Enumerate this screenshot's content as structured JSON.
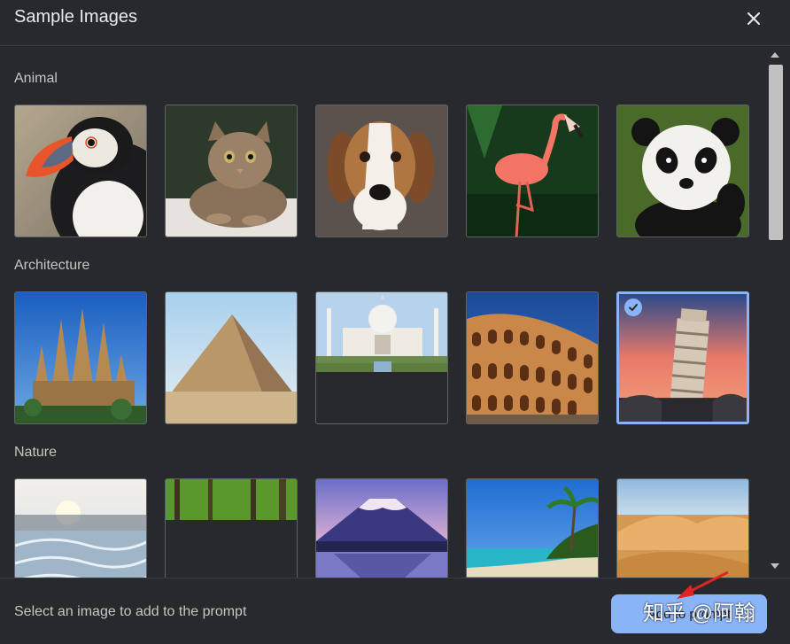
{
  "dialog": {
    "title": "Sample Images",
    "close_icon": "close-icon"
  },
  "sections": [
    {
      "label": "Animal",
      "images": [
        "puffin",
        "tabby-cat",
        "beagle",
        "flamingo",
        "panda"
      ]
    },
    {
      "label": "Architecture",
      "images": [
        "sagrada-familia",
        "pyramid",
        "taj-mahal",
        "colosseum",
        "leaning-tower-pisa"
      ]
    },
    {
      "label": "Nature",
      "images": [
        "frozen-waves",
        "forest",
        "mount-fuji",
        "tropical-beach",
        "desert-dunes"
      ]
    }
  ],
  "selected": "leaning-tower-pisa",
  "footer": {
    "hint": "Select an image to add to the prompt",
    "add_button": "Add to prompt"
  },
  "watermark": "知乎 @阿翰",
  "colors": {
    "accent": "#8ab4f8",
    "background": "#28292d"
  }
}
